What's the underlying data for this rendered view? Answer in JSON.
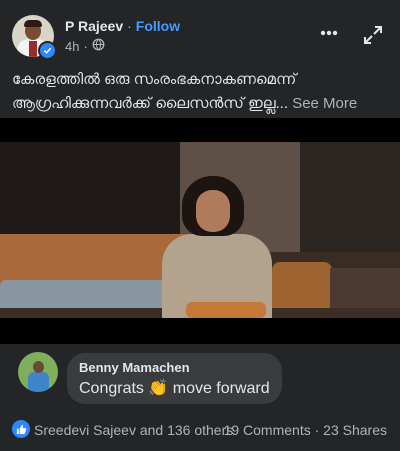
{
  "post": {
    "author": "P Rajeev",
    "separator": "·",
    "follow_label": "Follow",
    "time": "4h",
    "meta_separator": "·",
    "caption": "കേരളത്തിൽ ഒരു സംരംഭകനാകണമെന്ന് ആഗ്രഹിക്കുന്നവർക്ക് ലൈസൻസ് ഇല്ല...",
    "see_more_label": "See More",
    "icons": {
      "audience": "globe-icon",
      "more": "more-options-icon",
      "expand": "expand-icon",
      "verified": "verified-badge-icon"
    }
  },
  "comment": {
    "author": "Benny Mamachen",
    "text": "Congrats 👏 move forward"
  },
  "footer": {
    "reactors": "Sreedevi Sajeev and 136 others",
    "comments": "19 Comments",
    "separator": "·",
    "shares": "23 Shares"
  },
  "colors": {
    "background": "#242526",
    "accent": "#4599ff",
    "bubble": "#3a3b3c",
    "muted_text": "#b0b3b8"
  }
}
